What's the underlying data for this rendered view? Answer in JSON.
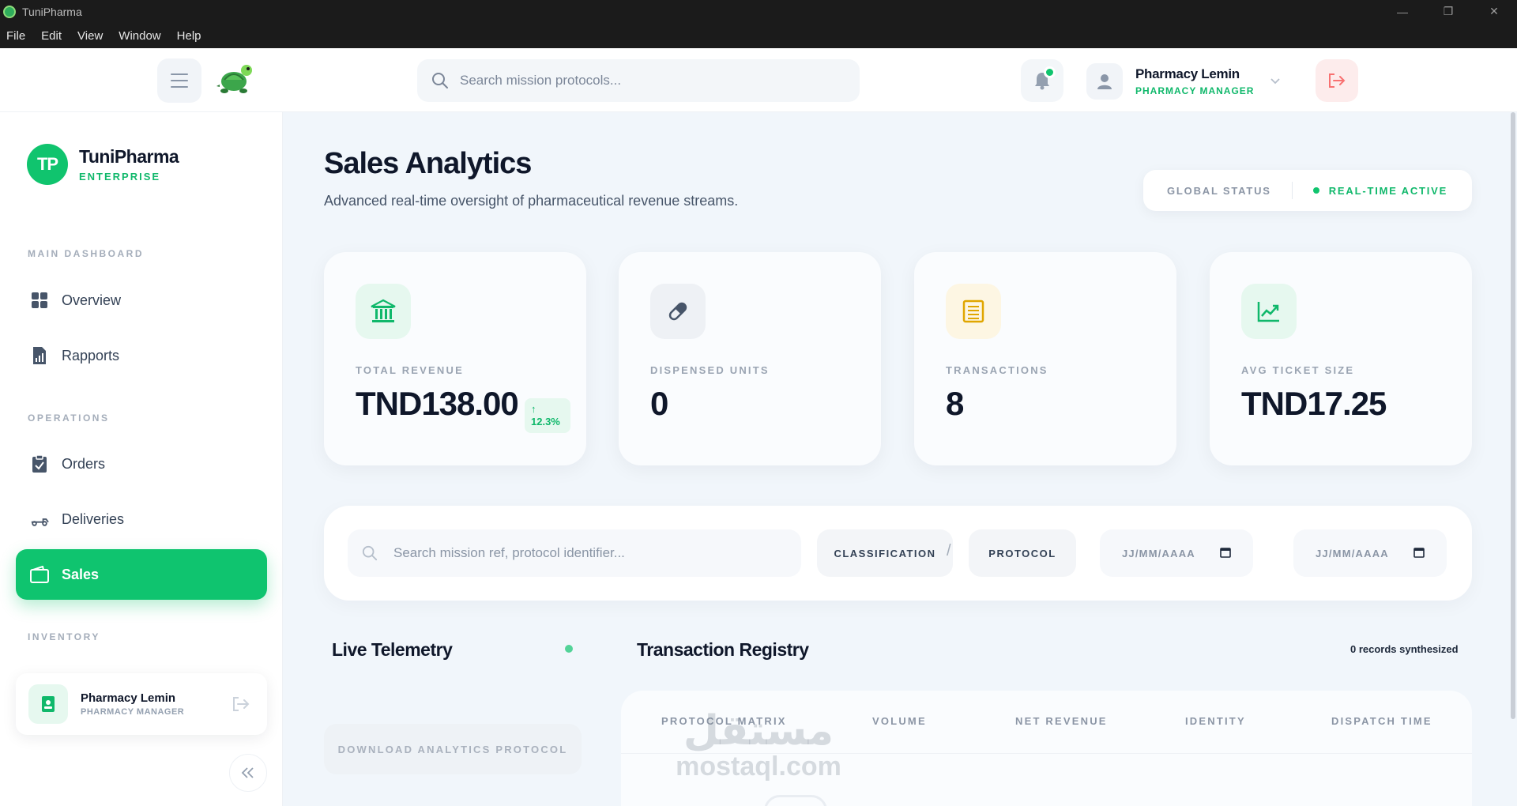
{
  "window": {
    "title": "TuniPharma",
    "menu": [
      "File",
      "Edit",
      "View",
      "Window",
      "Help"
    ],
    "controls": {
      "minimize": "—",
      "maximize": "❐",
      "close": "✕"
    }
  },
  "header": {
    "search_placeholder": "Search mission protocols...",
    "user": {
      "name": "Pharmacy Lemin",
      "role": "PHARMACY MANAGER"
    }
  },
  "sidebar": {
    "brand": {
      "initials": "TP",
      "name": "TuniPharma",
      "tagline": "ENTERPRISE"
    },
    "sections": {
      "main": "MAIN DASHBOARD",
      "operations": "OPERATIONS",
      "inventory": "INVENTORY"
    },
    "items": [
      {
        "label": "Overview",
        "icon": "grid-icon",
        "active": false
      },
      {
        "label": "Rapports",
        "icon": "report-icon",
        "active": false
      },
      {
        "label": "Orders",
        "icon": "clipboard-icon",
        "active": false
      },
      {
        "label": "Deliveries",
        "icon": "truck-icon",
        "active": false
      },
      {
        "label": "Sales",
        "icon": "wallet-icon",
        "active": true
      }
    ],
    "user": {
      "name": "Pharmacy Lemin",
      "role": "PHARMACY MANAGER"
    }
  },
  "main": {
    "title": "Sales Analytics",
    "subtitle": "Advanced real-time oversight of pharmaceutical revenue streams.",
    "status": {
      "label": "GLOBAL STATUS",
      "value": "REAL-TIME ACTIVE"
    },
    "kpis": [
      {
        "label": "TOTAL REVENUE",
        "value": "TND138.00",
        "trend": "12.3%",
        "icon": "bank-icon",
        "color": "#10b86b"
      },
      {
        "label": "DISPENSED UNITS",
        "value": "0",
        "icon": "pill-icon",
        "color": "#475569"
      },
      {
        "label": "TRANSACTIONS",
        "value": "8",
        "icon": "receipt-icon",
        "color": "#e0a600"
      },
      {
        "label": "AVG TICKET SIZE",
        "value": "TND17.25",
        "icon": "trend-up-icon",
        "color": "#10b86b"
      }
    ],
    "filters": {
      "search_placeholder": "Search mission ref, protocol identifier...",
      "classification": "CLASSIFICATION",
      "protocol": "PROTOCOL",
      "date_from": "JJ/MM/AAAA",
      "date_separator": "/",
      "date_to": "JJ/MM/AAAA"
    },
    "telemetry": {
      "title": "Live Telemetry",
      "download": "DOWNLOAD ANALYTICS PROTOCOL"
    },
    "registry": {
      "title": "Transaction Registry",
      "records": "0 records synthesized",
      "columns": [
        "PROTOCOL MATRIX",
        "VOLUME",
        "NET REVENUE",
        "IDENTITY",
        "DISPATCH TIME"
      ]
    }
  },
  "watermark": {
    "arabic": "مستقل",
    "latin": "mostaql.com"
  },
  "colors": {
    "accent": "#0fc46f",
    "danger": "#f87171",
    "warning": "#e0a600"
  }
}
